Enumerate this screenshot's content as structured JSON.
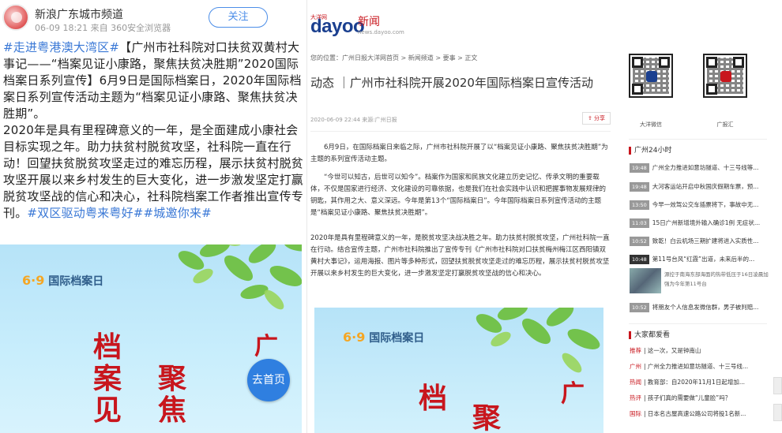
{
  "weibo": {
    "account_name": "新浪广东城市频道",
    "meta": "06-09 18:21 来自 360安全浏览器",
    "follow_label": "关注",
    "post_segments": [
      {
        "text": "#走进粤港澳大湾区#",
        "tag": true
      },
      {
        "text": "【广州市社科院对口扶贫双黄村大事记——“档案见证小康路，聚焦扶贫决胜期”2020国际档案日系列宣传】6月9日是国际档案日，2020年国际档案日系列宣传活动主题为“档案见证小康路、聚焦扶贫决胜期”。",
        "tag": false
      },
      {
        "text": "\n2020年是具有里程碑意义的一年，是全面建成小康社会目标实现之年。助力扶贫村脱贫攻坚，社科院一直在行动！回望扶贫脱贫攻坚走过的难忘历程，展示扶贫村脱贫攻坚开展以来乡村发生的巨大变化，进一步激发坚定打赢脱贫攻坚战的信心和决心，社科院档案工作者推出宣传专刊。",
        "tag": false
      },
      {
        "text": "#双区驱动粤来粤好##城邀你来#",
        "tag": true
      }
    ],
    "poster_title_num": "6·9",
    "poster_title": "国际档案日",
    "home_label": "去首页"
  },
  "dayoo": {
    "logo_text": "dayoo",
    "logo_sub": "大洋网",
    "logo_news": "新闻",
    "logo_url": "news.dayoo.com",
    "breadcrumb": "您的位置：广州日报大洋网首页 > 新闻频道 > 要事 > 正文",
    "title": "动态 ｜广州市社科院开展2020年国际档案日宣传活动",
    "meta": "2020-06-09 22:44    来源:广州日报",
    "share_label": "分享",
    "paragraphs": [
      "6月9日，在国际档案日来临之际，广州市社科院开展了以“档案见证小康路、聚焦扶贫决胜期”为主题的系列宣传活动主题。",
      "“今世可以知古，后世可以知今”。档案作为国家和民族文化建立历史记忆、传承文明的重要载体，不仅是国家进行经济、文化建设的可靠依据，也是我们在社会实践中认识和把握事物发展规律的钥匙，其作用之大、意义深远。今年是第13个“国际档案日”。今年国际档案日系列宣传活动的主题是“档案见证小康路、聚焦扶贫决胜期”。",
      "2020年是具有里程碑意义的一年，是脱贫攻坚决战决胜之年。助力扶贫村脱贫攻坚，广州社科院一直在行动。结合宣传主题，广州市社科院推出了宣传专刊《广州市社科院对口扶贫梅州梅江区西阳镇双黄村大事记》，运用海报、图片等多种形式，回望扶贫脱贫攻坚走过的难忘历程，展示扶贫村脱贫攻坚开展以来乡村发生的巨大变化，进一步激发坚定打赢脱贫攻坚战的信心和决心。"
    ],
    "poster_title_num": "6·9",
    "poster_title": "国际档案日"
  },
  "sidebar": {
    "qr_labels": [
      "大洋微信",
      "广报汇"
    ],
    "section1_title": "广州24小时",
    "news": [
      {
        "time": "19:48",
        "text": "广州全力推进如意坊隧道、十三号线等..."
      },
      {
        "time": "19:48",
        "text": "大河客运站开启中秋国庆假期车票，预..."
      },
      {
        "time": "13:50",
        "text": "今早一效驾公交车插票将下，事故中无..."
      },
      {
        "time": "11:03",
        "text": "15日广州新增境外输入确诊1例 无症状..."
      },
      {
        "time": "10:52",
        "text": "致乾！白云机场三期扩建将进入实质性..."
      },
      {
        "time": "10:48",
        "text": "第11号台风“红霞”出道，未来后半的..."
      }
    ],
    "thumb_text": "源控于南海东部海面的热带低压于16日凌晨加强为今年第11号台",
    "news_last": {
      "time": "10:52",
      "text": "将朋友个人信息发微信群，男子被判赔..."
    },
    "section2_title": "大家都爱看",
    "shares": [
      {
        "cat": "推荐",
        "text": "这一次，又是钟南山"
      },
      {
        "cat": "广州",
        "text": "广州全力推进如意坊隧道、十三号线..."
      },
      {
        "cat": "热闻",
        "text": "教育部：自2020年11月1日起增加..."
      },
      {
        "cat": "热评",
        "text": "孩子们真的需要做“儿童脸”吗？"
      },
      {
        "cat": "国际",
        "text": "日本名古屋高速公路公司将投1名新..."
      }
    ]
  }
}
